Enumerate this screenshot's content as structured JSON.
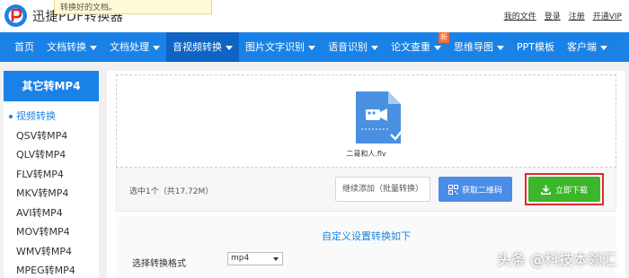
{
  "brand": {
    "name": "迅捷PDF转换器",
    "logo_icon": "p-logo-icon",
    "brand_color": "#1a82e6"
  },
  "tooltip": {
    "text": "转换好的文档。"
  },
  "toplinks": [
    "我的文件",
    "登录",
    "注册",
    "开通VIP"
  ],
  "nav": {
    "items": [
      {
        "label": "首页",
        "caret": false
      },
      {
        "label": "文档转换",
        "caret": true
      },
      {
        "label": "文档处理",
        "caret": true
      },
      {
        "label": "音视频转换",
        "caret": true,
        "active": true
      },
      {
        "label": "图片文字识别",
        "caret": true
      },
      {
        "label": "语音识别",
        "caret": true
      },
      {
        "label": "论文查重",
        "caret": true,
        "badge": "新"
      },
      {
        "label": "思维导图",
        "caret": true
      },
      {
        "label": "PPT模板",
        "caret": false
      },
      {
        "label": "客户端",
        "caret": true
      }
    ]
  },
  "sidebar": {
    "title": "其它转MP4",
    "items": [
      {
        "label": "视频转换",
        "active": true
      },
      {
        "label": "QSV转MP4"
      },
      {
        "label": "QLV转MP4"
      },
      {
        "label": "FLV转MP4"
      },
      {
        "label": "MKV转MP4"
      },
      {
        "label": "AVI转MP4"
      },
      {
        "label": "MOV转MP4"
      },
      {
        "label": "WMV转MP4"
      },
      {
        "label": "MPEG转MP4"
      }
    ]
  },
  "upload": {
    "file_name": "二哥和人.flv",
    "file_icon": "video-file-icon",
    "selected_info": "选中1个（共17.72M）"
  },
  "actions": {
    "continue_label": "继续添加（批量转换）",
    "qr_label": "获取二维码",
    "download_label": "立即下载",
    "download_color": "#3cb62a",
    "highlight_color": "#e3262d"
  },
  "custom": {
    "title": "自定义设置转换如下",
    "format_label": "选择转换格式",
    "format_value": "mp4"
  },
  "watermark": "头条 @科技本领汇"
}
